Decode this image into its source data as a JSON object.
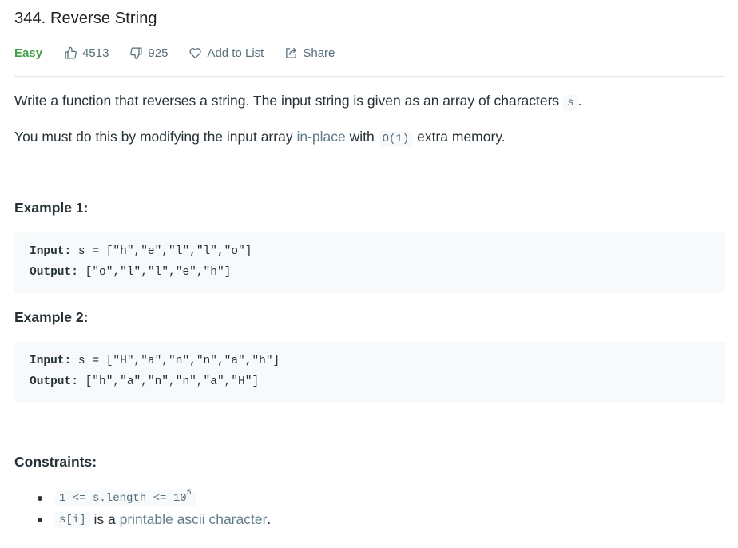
{
  "problem": {
    "title": "344. Reverse String",
    "difficulty": "Easy",
    "likes": "4513",
    "dislikes": "925",
    "add_to_list_label": "Add to List",
    "share_label": "Share",
    "difficulty_color": "#43a047"
  },
  "description": {
    "p1_text": "Write a function that reverses a string. The input string is given as an array of characters",
    "p1_code": "s",
    "p1_end": ".",
    "p2_start": "You must do this by modifying the input array",
    "p2_link": "in-place",
    "p2_mid": "with",
    "p2_code": "O(1)",
    "p2_end": "extra memory."
  },
  "examples": [
    {
      "heading": "Example 1:",
      "input_label": "Input:",
      "input_value": "s = [\"h\",\"e\",\"l\",\"l\",\"o\"]",
      "output_label": "Output:",
      "output_value": "[\"o\",\"l\",\"l\",\"e\",\"h\"]"
    },
    {
      "heading": "Example 2:",
      "input_label": "Input:",
      "input_value": "s = [\"H\",\"a\",\"n\",\"n\",\"a\",\"h\"]",
      "output_label": "Output:",
      "output_value": "[\"h\",\"a\",\"n\",\"n\",\"a\",\"H\"]"
    }
  ],
  "constraints": {
    "heading": "Constraints:",
    "c1_code": "1 <= s.length <= 10",
    "c1_sup": "5",
    "c2_code": "s[i]",
    "c2_mid": "is a",
    "c2_link": "printable ascii character",
    "c2_end": "."
  },
  "icons": {
    "likes": "thumbs-up-icon",
    "dislikes": "thumbs-down-icon",
    "add_to_list": "heart-icon",
    "share": "share-icon"
  }
}
